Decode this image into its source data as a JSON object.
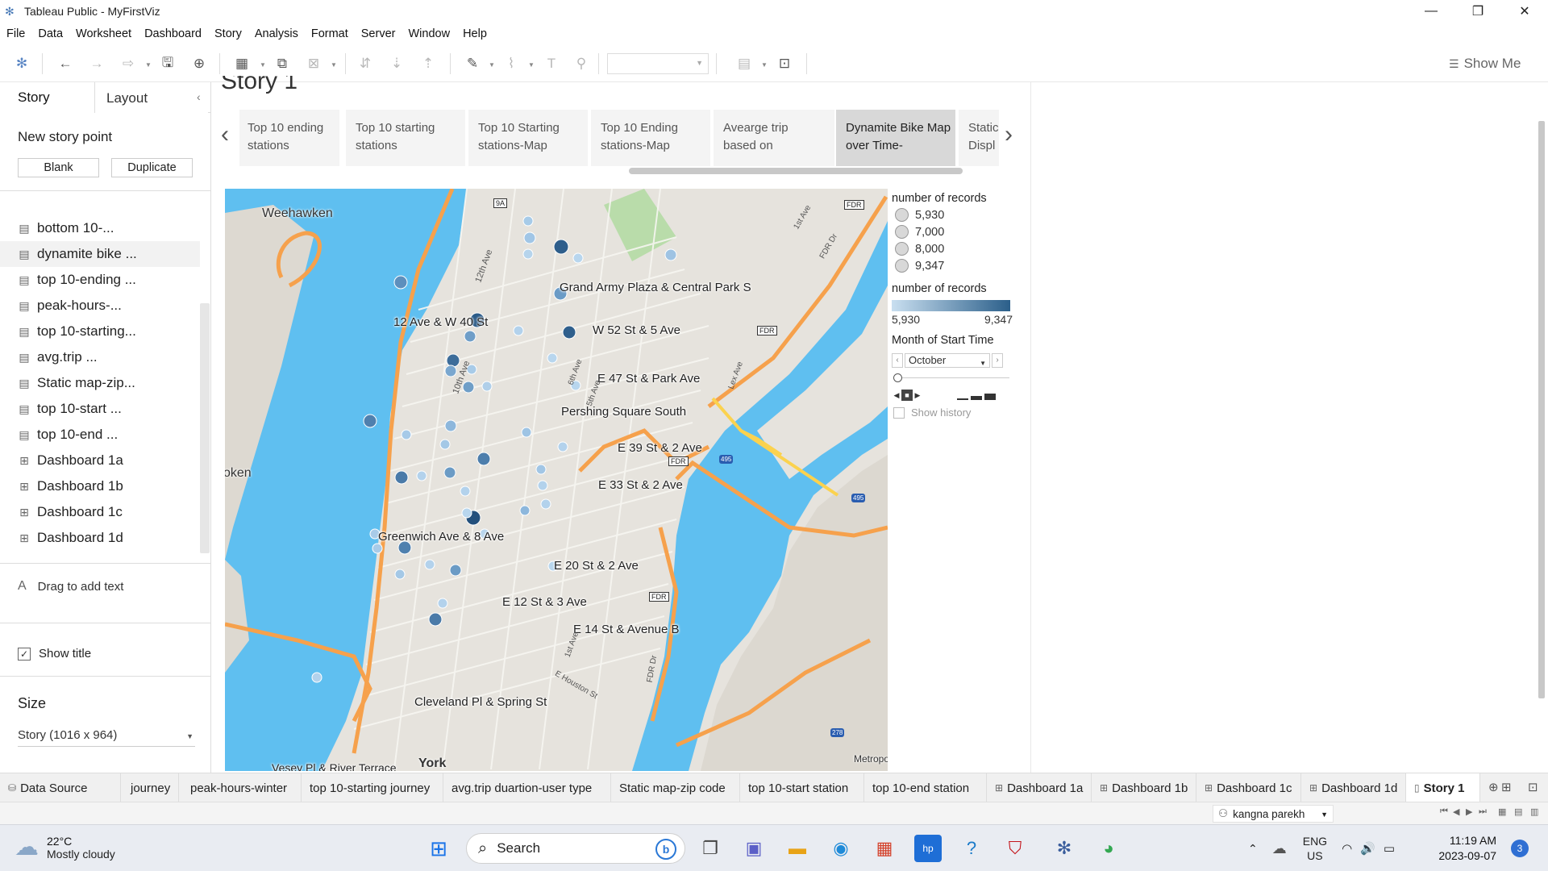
{
  "window": {
    "title": "Tableau Public - MyFirstViz",
    "controls": [
      "—",
      "❐",
      "✕"
    ]
  },
  "menu": [
    "File",
    "Data",
    "Worksheet",
    "Dashboard",
    "Story",
    "Analysis",
    "Format",
    "Server",
    "Window",
    "Help"
  ],
  "toolbar": {
    "show_me": "Show Me"
  },
  "left_pane": {
    "tabs": {
      "story": "Story",
      "layout": "Layout"
    },
    "new_story_point": "New story point",
    "blank_button": "Blank",
    "duplicate_button": "Duplicate",
    "items": [
      {
        "label": "bottom 10-...",
        "type": "sheet"
      },
      {
        "label": "dynamite bike ...",
        "type": "sheet"
      },
      {
        "label": "top 10-ending ...",
        "type": "sheet"
      },
      {
        "label": "peak-hours-...",
        "type": "sheet"
      },
      {
        "label": "top 10-starting...",
        "type": "sheet"
      },
      {
        "label": "avg.trip ...",
        "type": "sheet"
      },
      {
        "label": "Static map-zip...",
        "type": "sheet"
      },
      {
        "label": "top 10-start ...",
        "type": "sheet"
      },
      {
        "label": "top 10-end ...",
        "type": "sheet"
      },
      {
        "label": "Dashboard 1a",
        "type": "dashboard"
      },
      {
        "label": "Dashboard 1b",
        "type": "dashboard"
      },
      {
        "label": "Dashboard 1c",
        "type": "dashboard"
      },
      {
        "label": "Dashboard 1d",
        "type": "dashboard"
      }
    ],
    "drag_text": "Drag to add text",
    "drag_icon": "A",
    "show_title": "Show title",
    "size_label": "Size",
    "size_value": "Story (1016 x 964)"
  },
  "story": {
    "title": "Story 1",
    "points": [
      "Top 10 ending stations",
      "Top 10 starting stations",
      "Top 10 Starting stations-Map",
      "Top 10 Ending stations-Map",
      "Avearge trip based on",
      "Dynamite Bike Map over Time-",
      "Static Displ"
    ],
    "active_index": 5
  },
  "map": {
    "station_labels": [
      "Grand Army Plaza & Central Park S",
      "12 Ave & W 40 St",
      "W 52 St & 5 Ave",
      "E 47 St & Park Ave",
      "Pershing Square South",
      "E 39 St & 2 Ave",
      "E 33 St & 2 Ave",
      "Greenwich Ave & 8 Ave",
      "E 20 St & 2 Ave",
      "E 12 St & 3 Ave",
      "E 14 St & Avenue B",
      "Cleveland Pl & Spring St",
      "Vesey Pl & River Terrace"
    ],
    "geo_labels": [
      "Weehawken",
      "oken",
      "York",
      "Metropo"
    ],
    "road_shields": [
      "9A",
      "FDR",
      "FDR",
      "FDR",
      "FDR",
      "495",
      "495",
      "278"
    ],
    "street_labels": [
      "12th Ave",
      "10th Ave",
      "6th Ave",
      "5th Ave",
      "1st Ave",
      "FDR Dr",
      "E Houston St",
      "1st Ave",
      "Lex Ave",
      "FDR Dr"
    ]
  },
  "legend": {
    "size_title": "number of records",
    "size_values": [
      "5,930",
      "7,000",
      "8,000",
      "9,347"
    ],
    "color_title": "number of records",
    "color_min": "5,930",
    "color_max": "9,347",
    "color_low": "#c9dff0",
    "color_high": "#2b5f8a",
    "month_title": "Month of Start Time",
    "month_value": "October",
    "show_history": "Show history"
  },
  "sheet_tabs": [
    {
      "label": "Data Source",
      "icon": "database-icon"
    },
    {
      "label": "journey"
    },
    {
      "label": "peak-hours-winter"
    },
    {
      "label": "top 10-starting journey"
    },
    {
      "label": "avg.trip duartion-user type"
    },
    {
      "label": "Static map-zip code"
    },
    {
      "label": "top 10-start station"
    },
    {
      "label": "top 10-end station"
    },
    {
      "label": "Dashboard 1a",
      "icon": "dashboard-icon"
    },
    {
      "label": "Dashboard 1b",
      "icon": "dashboard-icon"
    },
    {
      "label": "Dashboard 1c",
      "icon": "dashboard-icon"
    },
    {
      "label": "Dashboard 1d",
      "icon": "dashboard-icon"
    },
    {
      "label": "Story 1",
      "icon": "story-icon",
      "active": true
    }
  ],
  "status": {
    "user": "kangna parekh"
  },
  "taskbar": {
    "weather_temp": "22°C",
    "weather_desc": "Mostly cloudy",
    "search": "Search",
    "lang1": "ENG",
    "lang2": "US",
    "time": "11:19 AM",
    "date": "2023-09-07",
    "notifications": "3"
  }
}
